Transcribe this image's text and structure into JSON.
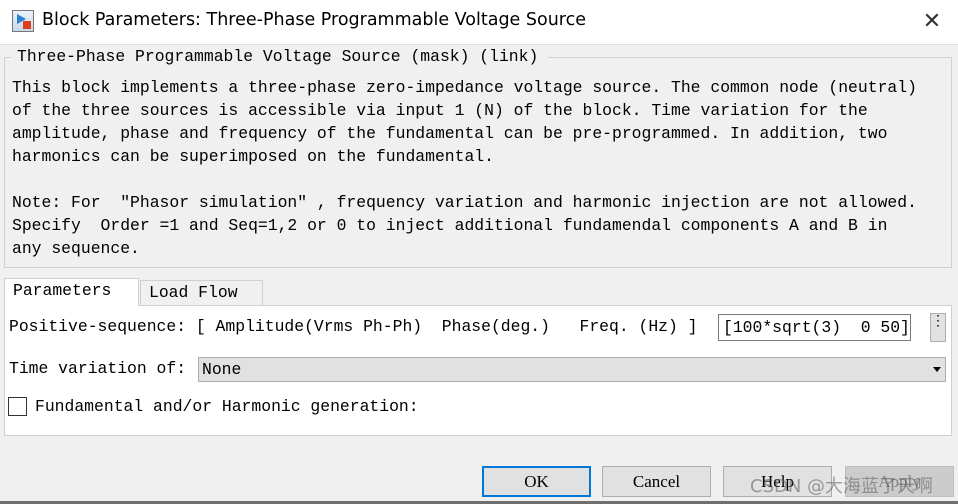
{
  "window": {
    "title": "Block Parameters: Three-Phase Programmable Voltage Source",
    "close_icon": "close-icon"
  },
  "group": {
    "legend": "Three-Phase Programmable Voltage Source (mask) (link)",
    "description": [
      "This block implements a three-phase zero-impedance voltage source. The common node (neutral)",
      "of the three sources is accessible via input 1 (N) of the block. Time variation for the",
      "amplitude, phase and frequency of the fundamental can be pre-programmed. In addition, two",
      "harmonics can be superimposed on the fundamental.",
      "",
      "Note: For  \"Phasor simulation\" , frequency variation and harmonic injection are not allowed.",
      "Specify  Order =1 and Seq=1,2 or 0 to inject additional fundamendal components A and B in",
      "any sequence."
    ]
  },
  "tabs": [
    {
      "label": "Parameters",
      "active": true
    },
    {
      "label": "Load Flow",
      "active": false
    }
  ],
  "params": {
    "positive_sequence_label": "Positive-sequence: [ Amplitude(Vrms Ph-Ph)  Phase(deg.)   Freq. (Hz) ]",
    "positive_sequence_value": "[100*sqrt(3)  0 50]",
    "more_button": "⋮",
    "time_variation_label": "Time variation of:",
    "time_variation_value": "None",
    "harmonic_label": "Fundamental and/or Harmonic generation:",
    "harmonic_checked": false
  },
  "buttons": {
    "ok": "OK",
    "cancel": "Cancel",
    "help": "Help",
    "apply": "Apply"
  },
  "watermark": "CSDN @大海蓝了天啊",
  "colors": {
    "accent": "#0078d7"
  }
}
